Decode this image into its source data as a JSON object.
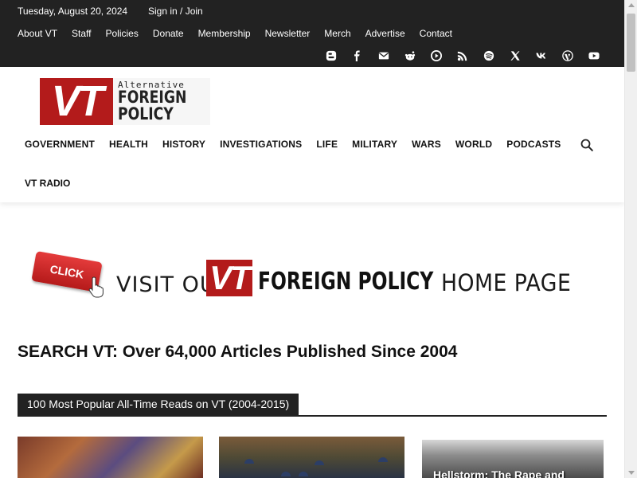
{
  "topbar": {
    "date": "Tuesday, August 20, 2024",
    "signin": "Sign in / Join",
    "links": [
      "About VT",
      "Staff",
      "Policies",
      "Donate",
      "Membership",
      "Newsletter",
      "Merch",
      "Advertise",
      "Contact"
    ],
    "social_icons": [
      "blogger-icon",
      "facebook-icon",
      "mail-icon",
      "reddit-icon",
      "rumble-icon",
      "rss-icon",
      "spotify-icon",
      "x-icon",
      "vk-icon",
      "wordpress-icon",
      "youtube-icon"
    ]
  },
  "logo": {
    "initials": "VT",
    "tagline": "Alternative",
    "name_line1": "FOREIGN",
    "name_line2": "POLICY"
  },
  "nav": {
    "items": [
      "GOVERNMENT",
      "HEALTH",
      "HISTORY",
      "INVESTIGATIONS",
      "LIFE",
      "MILITARY",
      "WARS",
      "WORLD",
      "PODCASTS"
    ],
    "second_row": "VT RADIO"
  },
  "banner": {
    "click_here": "CLICK HERE",
    "visit": "VISIT OUR",
    "initials": "VT",
    "foreign_policy": "FOREIGN POLICY",
    "home_page": "HOME PAGE"
  },
  "search_title": "SEARCH VT: Over 64,000 Articles Published Since 2004",
  "section_label": "100 Most Popular All-Time Reads on VT (2004-2015)",
  "articles": [
    {
      "title": ""
    },
    {
      "title": ""
    },
    {
      "title": "Hellstorm: The Rape and"
    }
  ],
  "colors": {
    "topbar_bg": "#222222",
    "brand_red": "#b31b1b"
  }
}
